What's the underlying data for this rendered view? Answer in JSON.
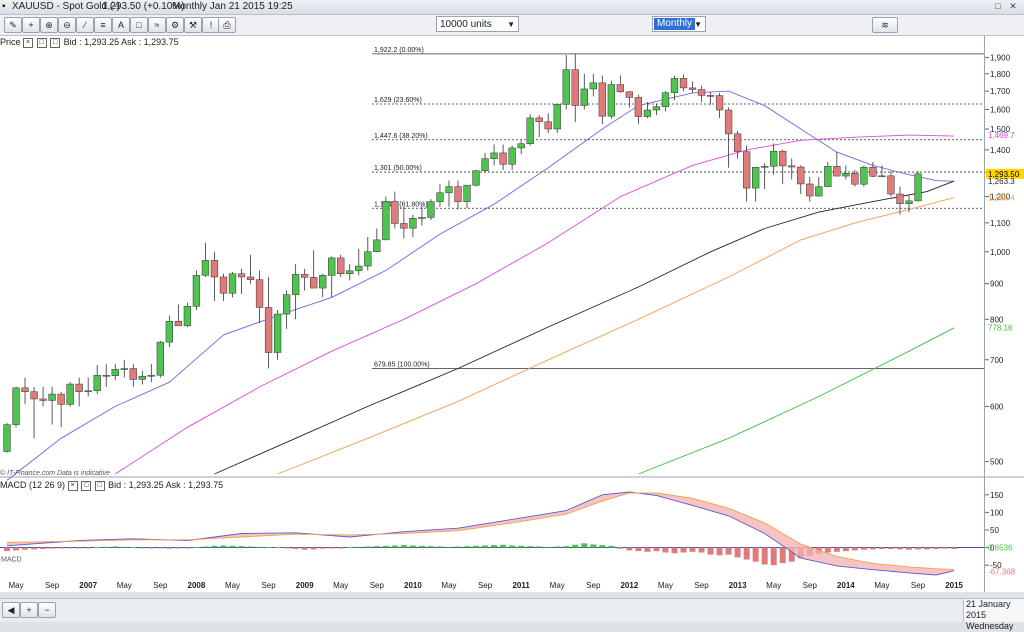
{
  "window": {
    "instrument": "XAUUSD - Spot Gold (-)",
    "quote": "1,293.50 (+0.10%)",
    "period_time": "Monthly Jan 21 2015 19:25"
  },
  "toolbar": {
    "units": "10000 units",
    "period": "Monthly"
  },
  "price_panel": {
    "legend": "Price",
    "bid_ask": "Bid : 1,293.25 Ask : 1,293.75",
    "disclaimer": "© IT-Finance.com Data is indicative"
  },
  "macd_panel": {
    "legend": "MACD (12 26 9)",
    "bid_ask": "Bid : 1,293.25 Ask : 1,293.75"
  },
  "status": {
    "date": "21 January 2015",
    "day": "Wednesday"
  },
  "colors": {
    "up": "#4fc24f",
    "down": "#e07b7b",
    "ma_blue": "#6a6ae0",
    "ma_pink": "#e048e0",
    "ma_black": "#222222",
    "ma_orange": "#f0a050",
    "ma_green": "#3cc03c"
  },
  "chart_data": {
    "type": "candlestick",
    "scale": "log",
    "ylim": [
      480,
      1960
    ],
    "price_ticks": [
      500,
      600,
      700,
      800,
      900,
      1000,
      1100,
      1200,
      1300,
      1400,
      1500,
      1600,
      1700,
      1800,
      1900
    ],
    "x_labels": [
      {
        "label": "May",
        "i": 1
      },
      {
        "label": "Sep",
        "i": 5
      },
      {
        "label": "2007",
        "i": 9
      },
      {
        "label": "May",
        "i": 13
      },
      {
        "label": "Sep",
        "i": 17
      },
      {
        "label": "2008",
        "i": 21
      },
      {
        "label": "May",
        "i": 25
      },
      {
        "label": "Sep",
        "i": 29
      },
      {
        "label": "2009",
        "i": 33
      },
      {
        "label": "May",
        "i": 37
      },
      {
        "label": "Sep",
        "i": 41
      },
      {
        "label": "2010",
        "i": 45
      },
      {
        "label": "May",
        "i": 49
      },
      {
        "label": "Sep",
        "i": 53
      },
      {
        "label": "2011",
        "i": 57
      },
      {
        "label": "May",
        "i": 61
      },
      {
        "label": "Sep",
        "i": 65
      },
      {
        "label": "2012",
        "i": 69
      },
      {
        "label": "May",
        "i": 73
      },
      {
        "label": "Sep",
        "i": 77
      },
      {
        "label": "2013",
        "i": 81
      },
      {
        "label": "May",
        "i": 85
      },
      {
        "label": "Sep",
        "i": 89
      },
      {
        "label": "2014",
        "i": 93
      },
      {
        "label": "May",
        "i": 97
      },
      {
        "label": "Sep",
        "i": 101
      },
      {
        "label": "2015",
        "i": 105
      }
    ],
    "candles": [
      [
        517,
        568,
        515,
        565
      ],
      [
        565,
        640,
        560,
        638
      ],
      [
        638,
        660,
        605,
        630
      ],
      [
        630,
        640,
        540,
        615
      ],
      [
        615,
        640,
        600,
        612
      ],
      [
        612,
        640,
        565,
        625
      ],
      [
        625,
        630,
        560,
        604
      ],
      [
        604,
        650,
        600,
        646
      ],
      [
        646,
        660,
        600,
        630
      ],
      [
        630,
        660,
        620,
        632
      ],
      [
        632,
        688,
        625,
        665
      ],
      [
        665,
        690,
        640,
        664
      ],
      [
        664,
        690,
        655,
        678
      ],
      [
        678,
        700,
        660,
        680
      ],
      [
        680,
        690,
        640,
        656
      ],
      [
        656,
        675,
        645,
        663
      ],
      [
        663,
        690,
        650,
        665
      ],
      [
        665,
        745,
        660,
        742
      ],
      [
        742,
        810,
        730,
        795
      ],
      [
        795,
        840,
        785,
        783
      ],
      [
        783,
        845,
        780,
        835
      ],
      [
        835,
        940,
        825,
        925
      ],
      [
        925,
        1030,
        920,
        972
      ],
      [
        972,
        1000,
        850,
        920
      ],
      [
        920,
        930,
        850,
        872
      ],
      [
        872,
        935,
        860,
        930
      ],
      [
        930,
        945,
        870,
        920
      ],
      [
        920,
        990,
        900,
        912
      ],
      [
        912,
        940,
        790,
        832
      ],
      [
        832,
        920,
        680,
        717
      ],
      [
        717,
        825,
        700,
        814
      ],
      [
        814,
        880,
        775,
        868
      ],
      [
        868,
        960,
        800,
        928
      ],
      [
        928,
        945,
        880,
        919
      ],
      [
        919,
        1005,
        890,
        887
      ],
      [
        887,
        930,
        860,
        925
      ],
      [
        925,
        985,
        860,
        980
      ],
      [
        980,
        990,
        920,
        930
      ],
      [
        930,
        960,
        910,
        939
      ],
      [
        939,
        1010,
        925,
        954
      ],
      [
        954,
        1050,
        940,
        1000
      ],
      [
        1000,
        1080,
        1000,
        1040
      ],
      [
        1040,
        1200,
        1040,
        1181
      ],
      [
        1181,
        1220,
        1080,
        1098
      ],
      [
        1098,
        1160,
        1045,
        1081
      ],
      [
        1081,
        1130,
        1050,
        1117
      ],
      [
        1117,
        1165,
        1090,
        1120
      ],
      [
        1120,
        1190,
        1110,
        1180
      ],
      [
        1180,
        1250,
        1160,
        1215
      ],
      [
        1215,
        1265,
        1160,
        1240
      ],
      [
        1240,
        1265,
        1150,
        1180
      ],
      [
        1180,
        1240,
        1155,
        1246
      ],
      [
        1246,
        1310,
        1240,
        1307
      ],
      [
        1307,
        1385,
        1300,
        1360
      ],
      [
        1360,
        1425,
        1330,
        1386
      ],
      [
        1386,
        1425,
        1310,
        1335
      ],
      [
        1335,
        1420,
        1310,
        1409
      ],
      [
        1409,
        1445,
        1380,
        1429
      ],
      [
        1429,
        1575,
        1420,
        1556
      ],
      [
        1556,
        1570,
        1460,
        1536
      ],
      [
        1536,
        1580,
        1480,
        1500
      ],
      [
        1500,
        1630,
        1480,
        1627
      ],
      [
        1627,
        1915,
        1600,
        1825
      ],
      [
        1825,
        1920,
        1535,
        1621
      ],
      [
        1621,
        1800,
        1600,
        1712
      ],
      [
        1712,
        1800,
        1670,
        1747
      ],
      [
        1747,
        1790,
        1525,
        1565
      ],
      [
        1565,
        1760,
        1550,
        1737
      ],
      [
        1737,
        1790,
        1690,
        1696
      ],
      [
        1696,
        1700,
        1610,
        1665
      ],
      [
        1665,
        1680,
        1525,
        1563
      ],
      [
        1563,
        1640,
        1555,
        1597
      ],
      [
        1597,
        1630,
        1570,
        1615
      ],
      [
        1615,
        1700,
        1590,
        1691
      ],
      [
        1691,
        1790,
        1650,
        1773
      ],
      [
        1773,
        1795,
        1700,
        1718
      ],
      [
        1718,
        1755,
        1690,
        1709
      ],
      [
        1709,
        1730,
        1640,
        1676
      ],
      [
        1676,
        1695,
        1625,
        1675
      ],
      [
        1675,
        1690,
        1555,
        1597
      ],
      [
        1597,
        1610,
        1320,
        1476
      ],
      [
        1476,
        1490,
        1360,
        1392
      ],
      [
        1392,
        1420,
        1180,
        1234
      ],
      [
        1234,
        1300,
        1180,
        1322
      ],
      [
        1322,
        1340,
        1230,
        1326
      ],
      [
        1326,
        1430,
        1290,
        1394
      ],
      [
        1394,
        1400,
        1250,
        1328
      ],
      [
        1328,
        1360,
        1270,
        1323
      ],
      [
        1323,
        1330,
        1210,
        1251
      ],
      [
        1251,
        1280,
        1180,
        1202
      ],
      [
        1202,
        1280,
        1200,
        1240
      ],
      [
        1240,
        1345,
        1240,
        1326
      ],
      [
        1326,
        1390,
        1320,
        1284
      ],
      [
        1284,
        1330,
        1270,
        1296
      ],
      [
        1296,
        1310,
        1240,
        1250
      ],
      [
        1250,
        1330,
        1240,
        1322
      ],
      [
        1322,
        1345,
        1280,
        1283
      ],
      [
        1283,
        1330,
        1280,
        1285
      ],
      [
        1285,
        1305,
        1200,
        1210
      ],
      [
        1210,
        1240,
        1130,
        1172
      ],
      [
        1172,
        1205,
        1140,
        1183
      ],
      [
        1183,
        1305,
        1180,
        1293.5
      ]
    ],
    "fib_levels": [
      {
        "label": "1,922.2 (0.00%)",
        "value": 1922.2,
        "style": "solid"
      },
      {
        "label": "1,629 (23.60%)",
        "value": 1629,
        "style": "dashed"
      },
      {
        "label": "1,447.6 (38.20%)",
        "value": 1447.6,
        "style": "dashed"
      },
      {
        "label": "1,301 (50.00%)",
        "value": 1301,
        "style": "dashed"
      },
      {
        "label": "1,154.4 (61.80%)",
        "value": 1154.4,
        "style": "dashed"
      },
      {
        "label": "679.85 (100.00%)",
        "value": 679.85,
        "style": "solid"
      }
    ],
    "moving_averages": [
      {
        "color": "#6a6ae0",
        "points": [
          [
            0,
            470
          ],
          [
            6,
            540
          ],
          [
            12,
            600
          ],
          [
            18,
            650
          ],
          [
            24,
            760
          ],
          [
            30,
            810
          ],
          [
            36,
            860
          ],
          [
            42,
            940
          ],
          [
            48,
            1060
          ],
          [
            54,
            1170
          ],
          [
            60,
            1320
          ],
          [
            66,
            1500
          ],
          [
            70,
            1620
          ],
          [
            76,
            1690
          ],
          [
            80,
            1700
          ],
          [
            84,
            1620
          ],
          [
            88,
            1500
          ],
          [
            92,
            1390
          ],
          [
            96,
            1330
          ],
          [
            100,
            1290
          ],
          [
            103,
            1265
          ],
          [
            105,
            1262
          ]
        ]
      },
      {
        "color": "#e048e0",
        "points": [
          [
            12,
            480
          ],
          [
            20,
            560
          ],
          [
            28,
            640
          ],
          [
            36,
            720
          ],
          [
            44,
            800
          ],
          [
            52,
            900
          ],
          [
            60,
            1030
          ],
          [
            68,
            1200
          ],
          [
            76,
            1330
          ],
          [
            82,
            1400
          ],
          [
            88,
            1445
          ],
          [
            94,
            1460
          ],
          [
            100,
            1470
          ],
          [
            105,
            1465
          ]
        ]
      },
      {
        "color": "#222222",
        "points": [
          [
            23,
            480
          ],
          [
            32,
            540
          ],
          [
            40,
            600
          ],
          [
            50,
            680
          ],
          [
            60,
            780
          ],
          [
            70,
            890
          ],
          [
            78,
            1000
          ],
          [
            84,
            1080
          ],
          [
            90,
            1140
          ],
          [
            96,
            1180
          ],
          [
            102,
            1220
          ],
          [
            105,
            1263
          ]
        ]
      },
      {
        "color": "#f0a050",
        "points": [
          [
            30,
            480
          ],
          [
            40,
            540
          ],
          [
            50,
            610
          ],
          [
            60,
            700
          ],
          [
            70,
            800
          ],
          [
            80,
            920
          ],
          [
            88,
            1040
          ],
          [
            94,
            1100
          ],
          [
            100,
            1150
          ],
          [
            105,
            1196
          ]
        ]
      },
      {
        "color": "#3cc03c",
        "points": [
          [
            70,
            480
          ],
          [
            80,
            540
          ],
          [
            90,
            620
          ],
          [
            100,
            720
          ],
          [
            105,
            778
          ]
        ]
      }
    ],
    "right_labels": [
      {
        "value": 1469.7,
        "text": "1,469.7",
        "color": "#e048e0"
      },
      {
        "value": 1293.5,
        "text": "1,293.50",
        "color": "#000000",
        "bg": "#ffd500"
      },
      {
        "value": 1263.3,
        "text": "1,263.3",
        "color": "#222222"
      },
      {
        "value": 1196.4,
        "text": "1,196.4",
        "color": "#f0a050"
      },
      {
        "value": 778.16,
        "text": "778.16",
        "color": "#3cc03c"
      }
    ],
    "macd": {
      "ylim": [
        -95,
        175
      ],
      "ticks": [
        150,
        100,
        50,
        0,
        -50
      ],
      "macd_line": [
        [
          0,
          5
        ],
        [
          8,
          20
        ],
        [
          14,
          25
        ],
        [
          20,
          20
        ],
        [
          26,
          40
        ],
        [
          32,
          42
        ],
        [
          38,
          30
        ],
        [
          44,
          45
        ],
        [
          50,
          55
        ],
        [
          56,
          80
        ],
        [
          62,
          105
        ],
        [
          66,
          150
        ],
        [
          69,
          158
        ],
        [
          72,
          148
        ],
        [
          76,
          120
        ],
        [
          80,
          90
        ],
        [
          84,
          40
        ],
        [
          88,
          -30
        ],
        [
          92,
          -52
        ],
        [
          96,
          -63
        ],
        [
          100,
          -72
        ],
        [
          103,
          -78
        ],
        [
          105,
          -66
        ]
      ],
      "signal_line": [
        [
          0,
          15
        ],
        [
          8,
          18
        ],
        [
          14,
          22
        ],
        [
          20,
          22
        ],
        [
          26,
          30
        ],
        [
          32,
          38
        ],
        [
          38,
          36
        ],
        [
          44,
          40
        ],
        [
          50,
          48
        ],
        [
          56,
          70
        ],
        [
          62,
          95
        ],
        [
          66,
          132
        ],
        [
          69,
          155
        ],
        [
          72,
          155
        ],
        [
          76,
          140
        ],
        [
          80,
          112
        ],
        [
          84,
          70
        ],
        [
          88,
          10
        ],
        [
          92,
          -25
        ],
        [
          96,
          -45
        ],
        [
          100,
          -55
        ],
        [
          103,
          -60
        ],
        [
          105,
          -62
        ]
      ],
      "histogram": [
        -10,
        -8,
        -6,
        -5,
        -4,
        -3,
        -2,
        -2,
        -1,
        0,
        1,
        2,
        3,
        2,
        1,
        0,
        -1,
        -2,
        -3,
        -2,
        -1,
        1,
        3,
        5,
        6,
        5,
        4,
        3,
        2,
        1,
        1,
        -2,
        -4,
        -6,
        -5,
        -3,
        -2,
        -1,
        1,
        2,
        3,
        4,
        5,
        6,
        7,
        6,
        5,
        4,
        3,
        2,
        3,
        4,
        5,
        6,
        7,
        8,
        6,
        5,
        4,
        3,
        2,
        3,
        4,
        8,
        12,
        9,
        7,
        5,
        -3,
        -8,
        -10,
        -12,
        -10,
        -14,
        -16,
        -14,
        -12,
        -14,
        -20,
        -22,
        -20,
        -28,
        -34,
        -40,
        -48,
        -50,
        -44,
        -40,
        -30,
        -24,
        -18,
        -14,
        -12,
        -10,
        -8,
        -6,
        -5,
        -4,
        -4,
        -5,
        -6,
        -5,
        -5,
        -4,
        -3,
        -4
      ],
      "left_label": "MACD",
      "right_labels": [
        {
          "value": 0.8536,
          "text": "0.8536",
          "color": "#4fc24f"
        },
        {
          "value": -67.368,
          "text": "-67.368",
          "color": "#e07b7b"
        }
      ]
    }
  }
}
